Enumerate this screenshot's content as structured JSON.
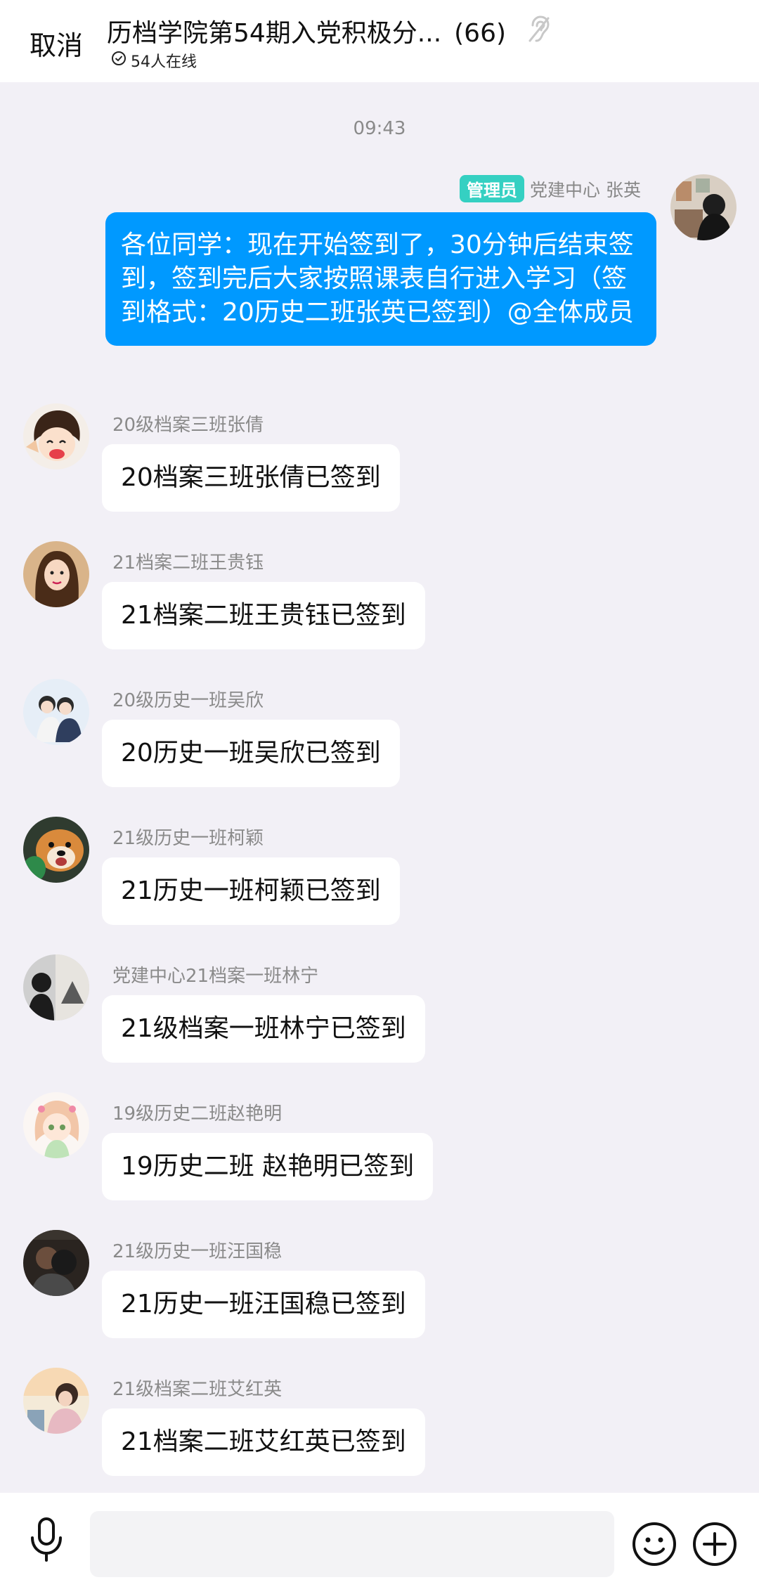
{
  "header": {
    "cancel_label": "取消",
    "title": "历档学院第54期入党积极分...",
    "member_count": "(66)",
    "online_text": "54人在线"
  },
  "chat": {
    "time": "09:43",
    "admin_message": {
      "badge": "管理员",
      "sender": "党建中心 张英",
      "text": "各位同学：现在开始签到了，30分钟后结束签到，签到完后大家按照课表自行进入学习（签到格式：20历史二班张英已签到）@全体成员"
    },
    "messages": [
      {
        "name": "20级档案三班张倩",
        "text": "20档案三班张倩已签到"
      },
      {
        "name": "21档案二班王贵钰",
        "text": "21档案二班王贵钰已签到"
      },
      {
        "name": "20级历史一班吴欣",
        "text": "20历史一班吴欣已签到"
      },
      {
        "name": "21级历史一班柯颖",
        "text": "21历史一班柯颖已签到"
      },
      {
        "name": "党建中心21档案一班林宁",
        "text": "21级档案一班林宁已签到"
      },
      {
        "name": "19级历史二班赵艳明",
        "text": "19历史二班 赵艳明已签到"
      },
      {
        "name": "21级历史一班汪国稳",
        "text": "21历史一班汪国稳已签到"
      },
      {
        "name": "21级档案二班艾红英",
        "text": "21档案二班艾红英已签到"
      }
    ]
  },
  "colors": {
    "admin_bubble": "#0099ff",
    "badge": "#35d0c2",
    "background": "#f2f0f6"
  },
  "icons": {
    "mic": "mic-icon",
    "emoji": "emoji-icon",
    "plus": "plus-icon",
    "ear": "ear-icon",
    "online": "check-circle-icon"
  }
}
